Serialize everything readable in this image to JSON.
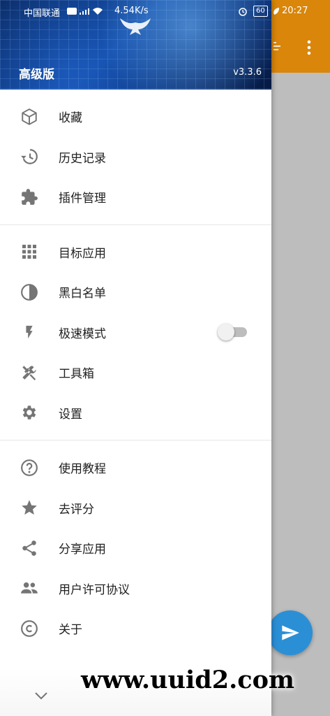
{
  "status_bar": {
    "carrier": "中国联通",
    "network_speed": "4.54K/s",
    "battery": "60",
    "time": "20:27"
  },
  "drawer": {
    "header": {
      "title": "高级版",
      "version": "v3.3.6"
    },
    "groups": [
      [
        {
          "label": "收藏",
          "icon": "cube-icon"
        },
        {
          "label": "历史记录",
          "icon": "history-icon"
        },
        {
          "label": "插件管理",
          "icon": "puzzle-icon"
        }
      ],
      [
        {
          "label": "目标应用",
          "icon": "grid-icon"
        },
        {
          "label": "黑白名单",
          "icon": "contrast-icon"
        },
        {
          "label": "极速模式",
          "icon": "flash-icon",
          "toggle": "off"
        },
        {
          "label": "工具箱",
          "icon": "tools-icon"
        },
        {
          "label": "设置",
          "icon": "gear-icon"
        }
      ],
      [
        {
          "label": "使用教程",
          "icon": "help-icon"
        },
        {
          "label": "去评分",
          "icon": "star-icon"
        },
        {
          "label": "分享应用",
          "icon": "share-icon"
        },
        {
          "label": "用户许可协议",
          "icon": "people-icon"
        },
        {
          "label": "关于",
          "icon": "copyright-icon"
        }
      ]
    ]
  },
  "watermark": "www.uuid2.com",
  "colors": {
    "toolbar": "#d9860a",
    "fab": "#2b8fd6",
    "icon": "#757575",
    "text": "#212121"
  }
}
